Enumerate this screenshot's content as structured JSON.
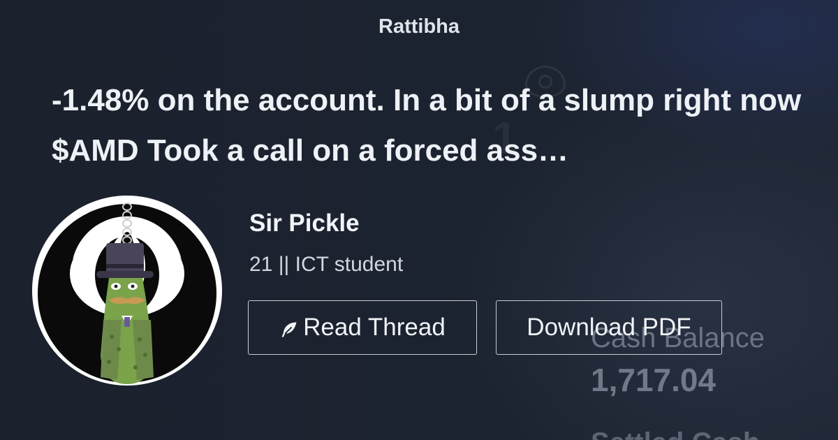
{
  "brand": "Rattibha",
  "thread": {
    "title": "-1.48% on the account. In a bit of a slump right now $AMD Took a call on a forced ass…"
  },
  "author": {
    "name": "Sir Pickle",
    "bio": "21 || ICT student"
  },
  "actions": {
    "read_label": "Read Thread",
    "pdf_label": "Download PDF"
  },
  "background_screenshot": {
    "label": "Cash Balance",
    "value": "1,717.04",
    "partial_label": "Settled Cash"
  },
  "icons": {
    "read": "feather-icon"
  },
  "colors": {
    "background": "#1c2330",
    "text": "#eef1f5",
    "button_border": "#c9ced7"
  }
}
